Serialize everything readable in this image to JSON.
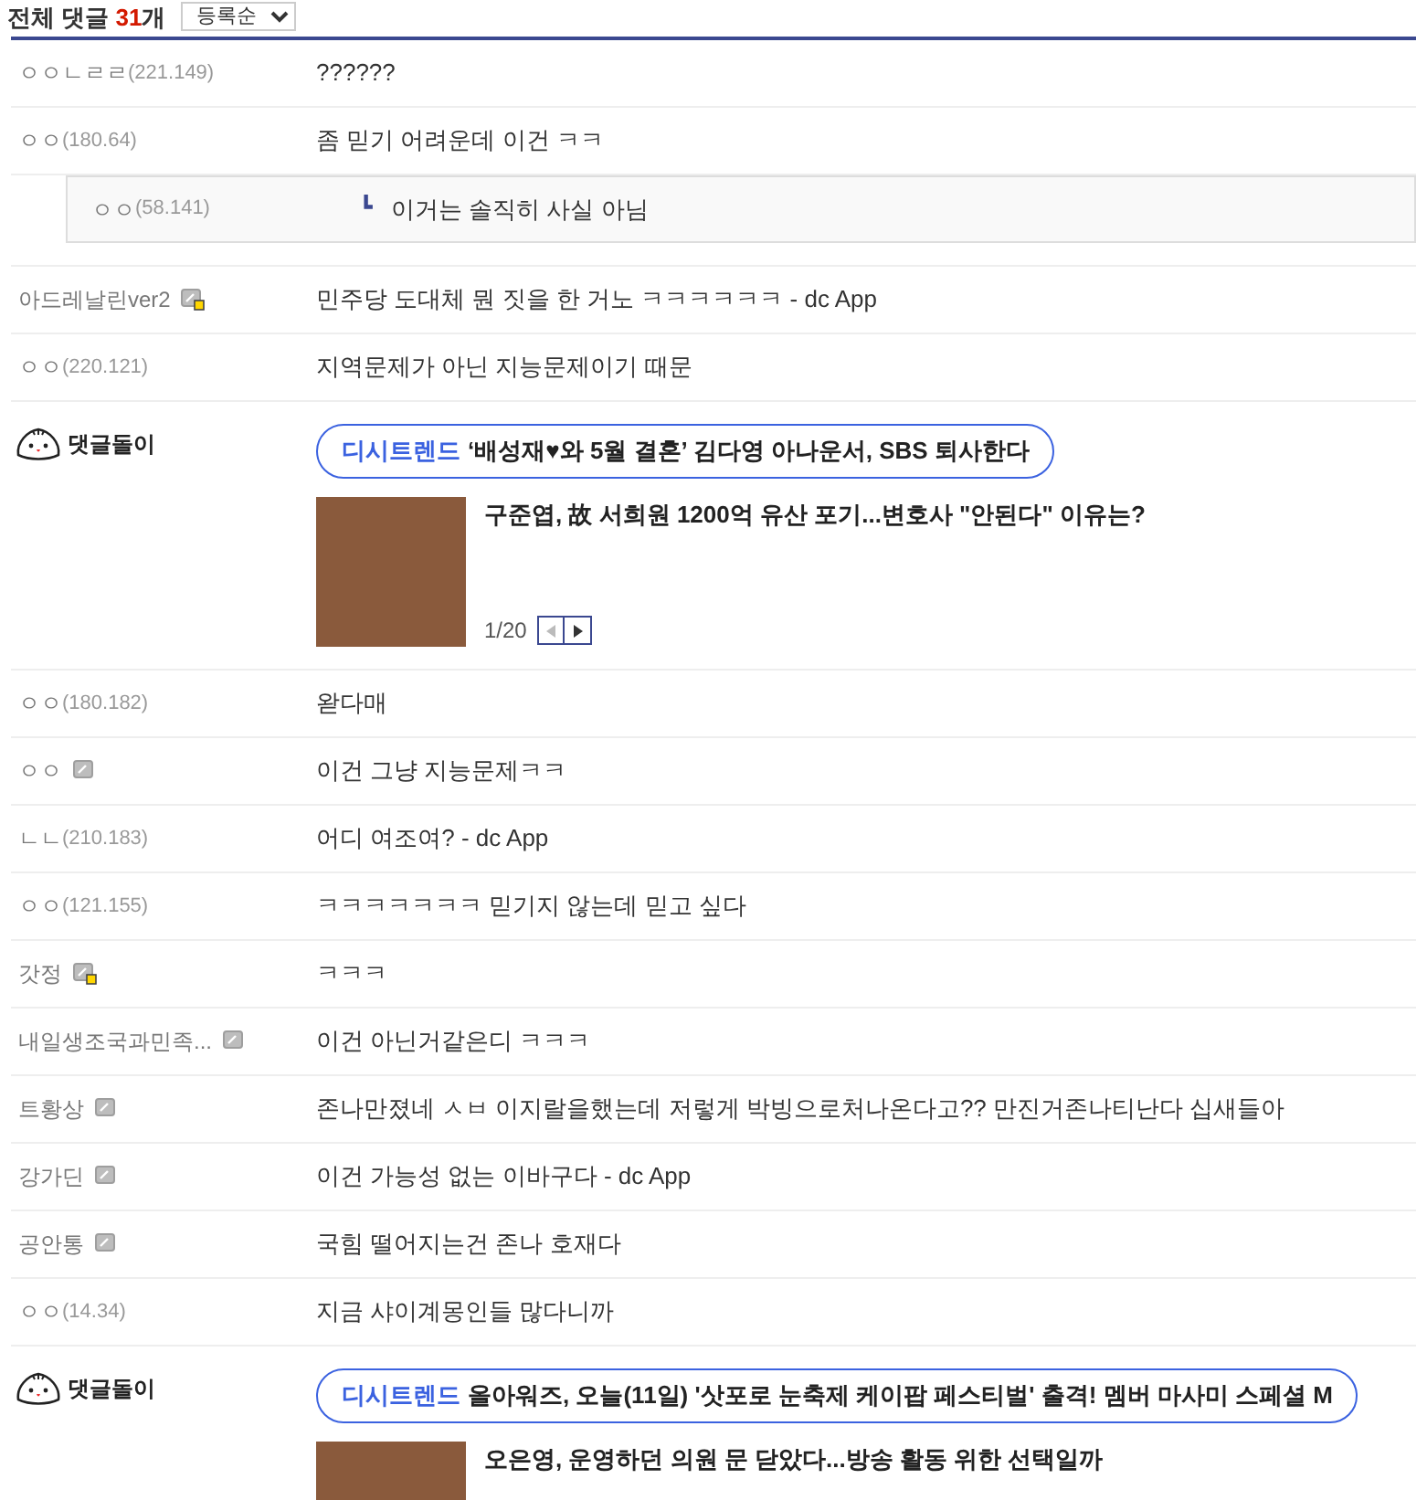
{
  "header": {
    "label": "전체 댓글",
    "count": "31",
    "unit": "개",
    "sort": "등록순"
  },
  "comments": [
    {
      "kind": "comment",
      "name": "ㅇㅇㄴㄹㄹ",
      "ip": "(221.149)",
      "text": "??????"
    },
    {
      "kind": "comment",
      "name": "ㅇㅇ",
      "ip": "(180.64)",
      "text": "좀 믿기 어려운데 이건 ㅋㅋ"
    },
    {
      "kind": "reply",
      "name": "ㅇㅇ",
      "ip": "(58.141)",
      "mark": "┗",
      "text": "이거는 솔직히 사실 아님"
    },
    {
      "kind": "comment",
      "name": "아드레날린ver2",
      "gallog": true,
      "fixed": true,
      "text": "민주당 도대체 뭔 짓을 한 거노 ㅋㅋㅋㅋㅋㅋ - dc App"
    },
    {
      "kind": "comment",
      "name": "ㅇㅇ",
      "ip": "(220.121)",
      "text": "지역문제가 아닌 지능문제이기 때문"
    },
    {
      "kind": "bot",
      "name": "댓글돌이",
      "tag": "디시트렌드",
      "headline": "‘배성재♥와 5월 결혼’ 김다영 아나운서, SBS 퇴사한다",
      "news": "구준엽, 故 서희원 1200억 유산 포기...변호사 \"안된다\" 이유는?",
      "page": "1/20",
      "prev_disabled": true
    },
    {
      "kind": "comment",
      "name": "ㅇㅇ",
      "ip": "(180.182)",
      "text": "왇다매"
    },
    {
      "kind": "comment",
      "name": "ㅇㅇ",
      "gallog": true,
      "fixed": false,
      "text": "이건 그냥 지능문제ㅋㅋ"
    },
    {
      "kind": "comment",
      "name": "ㄴㄴ",
      "ip": "(210.183)",
      "text": "어디 여조여? - dc App"
    },
    {
      "kind": "comment",
      "name": "ㅇㅇ",
      "ip": "(121.155)",
      "text": "ㅋㅋㅋㅋㅋㅋㅋ 믿기지 않는데 믿고 싶다"
    },
    {
      "kind": "comment",
      "name": "갓정",
      "gallog": true,
      "fixed": true,
      "text": "ㅋㅋㅋ"
    },
    {
      "kind": "comment",
      "name": "내일생조국과민족...",
      "gallog": true,
      "fixed": false,
      "text": "이건 아닌거같은디 ㅋㅋㅋ"
    },
    {
      "kind": "comment",
      "name": "트황상",
      "gallog": true,
      "fixed": false,
      "text": "존나만졌네 ㅅㅂ 이지랄을했는데 저렇게 박빙으로처나온다고?? 만진거존나티난다 십새들아"
    },
    {
      "kind": "comment",
      "name": "강가딘",
      "gallog": true,
      "fixed": false,
      "text": "이건 가능성 없는 이바구다 - dc App"
    },
    {
      "kind": "comment",
      "name": "공안통",
      "gallog": true,
      "fixed": false,
      "text": "국힘 떨어지는건 존나 호재다"
    },
    {
      "kind": "comment",
      "name": "ㅇㅇ",
      "ip": "(14.34)",
      "text": "지금 샤이계몽인들 많다니까"
    },
    {
      "kind": "bot",
      "name": "댓글돌이",
      "tag": "디시트렌드",
      "headline": "올아워즈, 오늘(11일) '삿포로 눈축제 케이팝 페스티벌' 출격! 멤버 마사미 스페셜 M",
      "news": "오은영, 운영하던 의원 문 닫았다...방송 활동 위한 선택일까"
    }
  ]
}
